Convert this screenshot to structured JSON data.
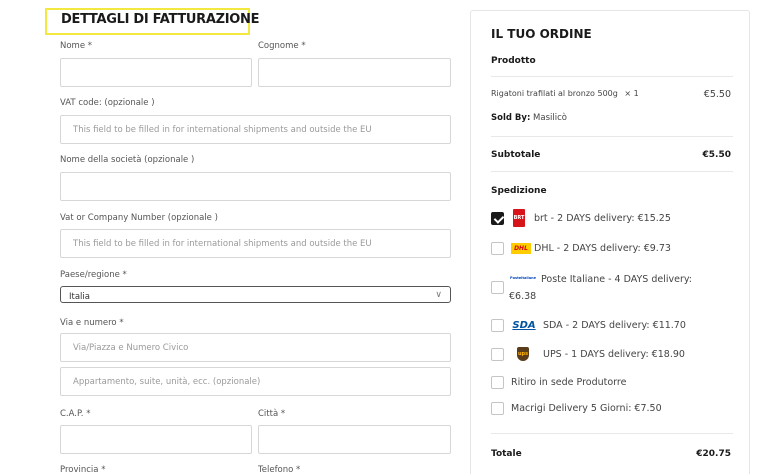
{
  "billing": {
    "title": "DETTAGLI DI FATTURAZIONE",
    "first_name_label": "Nome *",
    "last_name_label": "Cognome *",
    "vat_label": "VAT code: (opzionale )",
    "vat_placeholder": "This field to be filled in for international shipments and outside the EU",
    "company_label": "Nome della società (opzionale )",
    "company_number_label": "Vat or Company Number (opzionale )",
    "company_number_placeholder": "This field to be filled in for international shipments and outside the EU",
    "country_label": "Paese/regione *",
    "country_value": "Italia",
    "street_label": "Via e numero *",
    "street_placeholder": "Via/Piazza e Numero Civico",
    "apartment_placeholder": "Appartamento, suite, unità, ecc. (opzionale)",
    "zip_label": "C.A.P. *",
    "city_label": "Città *",
    "province_label": "Provincia *",
    "phone_label": "Telefono *"
  },
  "order": {
    "title": "IL TUO ORDINE",
    "product_header": "Prodotto",
    "product_name": "Rigatoni trafilati al bronzo 500g",
    "product_qty": "× 1",
    "product_price": "€5.50",
    "sold_by_label": "Sold By:",
    "sold_by_value": "Masilicò",
    "subtotal_label": "Subtotale",
    "subtotal_value": "€5.50",
    "shipping_label": "Spedizione",
    "shipping_options": [
      {
        "label": "brt - 2 DAYS delivery: €15.25",
        "checked": true,
        "logo": "brt-logo"
      },
      {
        "label": "DHL - 2 DAYS delivery: €9.73",
        "checked": false,
        "logo": "dhl-logo"
      },
      {
        "label": "Poste Italiane - 4 DAYS delivery:",
        "label_cont": "€6.38",
        "checked": false,
        "logo": "poste-italiane-logo",
        "logo_text": "Posteitaliane"
      },
      {
        "label": "SDA - 2 DAYS delivery: €11.70",
        "checked": false,
        "logo": "sda-logo",
        "logo_text": "SDA"
      },
      {
        "label": "UPS - 1 DAYS delivery: €18.90",
        "checked": false,
        "logo": "ups-logo",
        "logo_text": "ups"
      },
      {
        "label": "Ritiro in sede Produtorre",
        "checked": false
      },
      {
        "label": "Macrigi Delivery 5 Giorni: €7.50",
        "checked": false
      }
    ],
    "total_label": "Totale",
    "total_value": "€20.75"
  },
  "colors": {
    "highlight": "#f3e840",
    "brt_red": "#d7141a",
    "dhl_yellow": "#ffcc00",
    "dhl_red": "#d40511",
    "sda_blue": "#0053a0",
    "ups_brown": "#5a3b1a",
    "poste_blue": "#0047bb"
  }
}
